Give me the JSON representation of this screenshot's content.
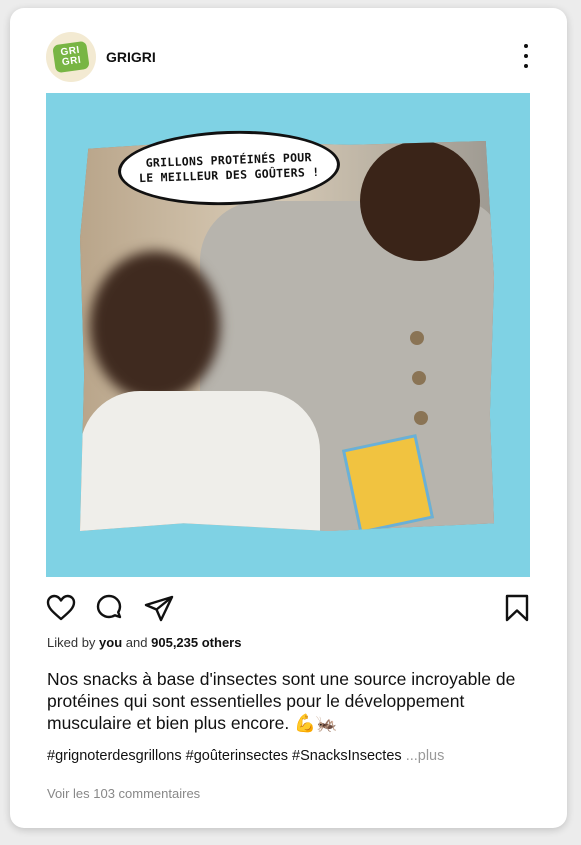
{
  "post": {
    "username": "GRIGRI",
    "avatar_logo": [
      "GRI",
      "GRI"
    ],
    "image": {
      "speech_bubble": "GRILLONS PROTÉINÉS POUR\nLE MEILLEUR DES GOÛTERS !",
      "background_color": "#7fd2e4"
    },
    "actions": {
      "like_icon": "heart-outline-icon",
      "comment_icon": "comment-bubble-icon",
      "share_icon": "paper-plane-icon",
      "save_icon": "bookmark-icon",
      "more_icon": "more-vertical-icon"
    },
    "likes": {
      "prefix": "Liked by",
      "user": "you",
      "conjunction": "and",
      "count": "905,235 others"
    },
    "caption": "Nos snacks à base d'insectes sont une source incroyable de protéines qui sont essentielles pour le développement musculaire et bien plus encore. 💪🦗",
    "hashtags": "#grignoterdesgrillons #goûterinsectes #SnacksInsectes",
    "more_label": "...plus",
    "comments_link": "Voir les 103 commentaires"
  }
}
